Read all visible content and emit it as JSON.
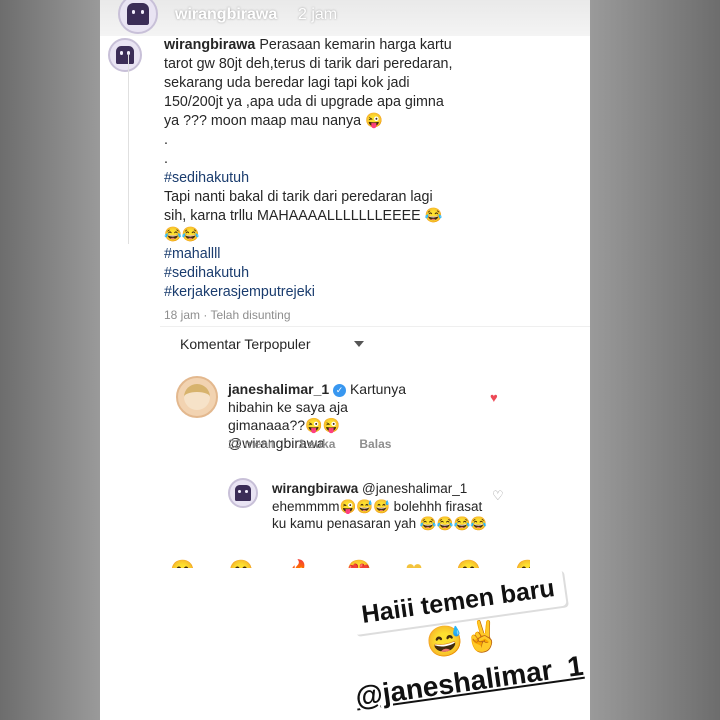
{
  "header": {
    "username": "wirangbirawa",
    "time": "2 jam"
  },
  "caption": {
    "username": "wirangbirawa",
    "text": "Perasaan kemarin harga kartu tarot gw 80jt deh,terus di tarik dari peredaran, sekarang uda beredar lagi tapi kok jadi 150/200jt ya ,apa uda di upgrade apa gimna ya ??? moon maap mau nanya 😜\n.\n.\n",
    "tag1": "#sedihakutuh",
    "text2": "\nTapi nanti bakal di tarik dari peredaran lagi sih, karna trllu MAHAAAALLLLLLLEEEE 😂😂😂\n",
    "tag2": "#mahallll",
    "tag3": "#sedihakutuh",
    "tag4": "#kerjakerasjemputrejeki",
    "meta": "18 jam · Telah disunting"
  },
  "sort": {
    "label": "Komentar Terpopuler"
  },
  "comment1": {
    "username": "janeshalimar_1",
    "verified_icon": "✓",
    "text": "Kartunya hibahin ke saya aja gimanaaa??😜😜 @wirangbirawa",
    "time": "22 menit",
    "likes": "1 suka",
    "reply": "Balas",
    "heart": "♥"
  },
  "comment2": {
    "username": "wirangbirawa",
    "text": "@janeshalimar_1 ehemmmm😜😅😅 bolehhh firasat ku kamu penasaran yah 😂😂😂😂",
    "heart": "♡"
  },
  "emoji_strip": [
    "😊",
    "😊",
    "🔥",
    "😍",
    "❤",
    "😊",
    "😊",
    "😊"
  ],
  "sticker": {
    "line1": "Haiii temen baru",
    "emojis": "😅✌️",
    "mention": "@janeshalimar_1"
  }
}
